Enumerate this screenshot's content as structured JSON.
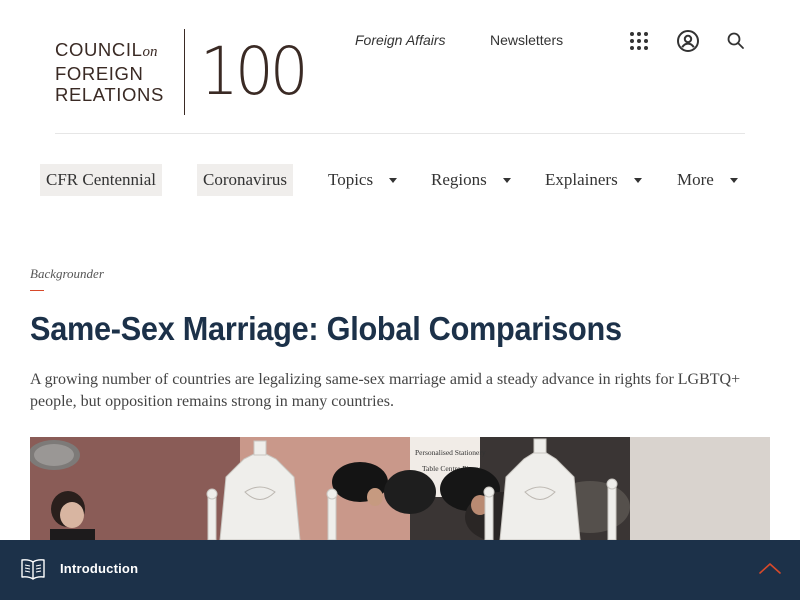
{
  "header": {
    "logo": {
      "line1": "COUNCIL",
      "line1_suffix": "on",
      "line2": "FOREIGN",
      "line3": "RELATIONS",
      "centennial": "100"
    },
    "links": {
      "foreign_affairs": "Foreign Affairs",
      "newsletters": "Newsletters"
    },
    "icons": [
      "apps-grid-icon",
      "user-account-icon",
      "search-icon"
    ]
  },
  "nav": {
    "items": [
      {
        "label": "CFR Centennial",
        "highlighted": true,
        "dropdown": false
      },
      {
        "label": "Coronavirus",
        "highlighted": true,
        "dropdown": false
      },
      {
        "label": "Topics",
        "highlighted": false,
        "dropdown": true
      },
      {
        "label": "Regions",
        "highlighted": false,
        "dropdown": true
      },
      {
        "label": "Explainers",
        "highlighted": false,
        "dropdown": true
      },
      {
        "label": "More",
        "highlighted": false,
        "dropdown": true
      }
    ]
  },
  "article": {
    "type": "Backgrounder",
    "title": "Same-Sex Marriage: Global Comparisons",
    "summary": "A growing number of countries are legalizing same-sex marriage amid a steady advance in rights for LGBTQ+ people, but opposition remains strong in many countries.",
    "hero_sign_text": [
      "Personalised Stationery",
      "Table Centre Pieces"
    ]
  },
  "bottom_bar": {
    "label": "Introduction",
    "icons": [
      "book-icon",
      "chevron-up-icon"
    ]
  },
  "colors": {
    "navy": "#1c3149",
    "accent_red": "#d7492a",
    "logo_brown": "#3a2a24",
    "nav_pill_bg": "#f0eeec"
  }
}
